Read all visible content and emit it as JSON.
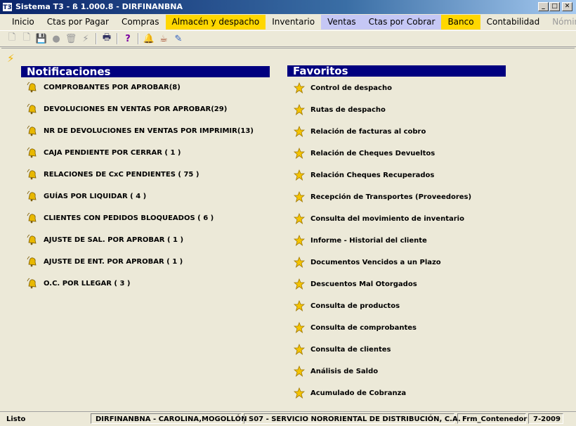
{
  "window": {
    "title": "Sistema T3 - ß 1.000.8 - DIRFINANBNA",
    "icon_label": "T3",
    "controls": [
      "minimize",
      "maximize",
      "close"
    ]
  },
  "menu": [
    {
      "label": "Inicio",
      "style": "normal"
    },
    {
      "label": "Ctas por Pagar",
      "style": "normal"
    },
    {
      "label": "Compras",
      "style": "normal"
    },
    {
      "label": "Almacén y despacho",
      "style": "yellow"
    },
    {
      "label": "Inventario",
      "style": "normal"
    },
    {
      "label": "Ventas",
      "style": "blue"
    },
    {
      "label": "Ctas por Cobrar",
      "style": "blue"
    },
    {
      "label": "Banco",
      "style": "yellow"
    },
    {
      "label": "Contabilidad",
      "style": "normal"
    },
    {
      "label": "Nómina",
      "style": "disabled"
    }
  ],
  "colors": {
    "yellow_menu": "#ffd700",
    "blue_menu": "#c5c7f5",
    "section_header": "#00007f"
  },
  "toolbar": [
    {
      "icon": "new-document-icon",
      "enabled": false
    },
    {
      "icon": "open-document-icon",
      "enabled": false
    },
    {
      "icon": "save-icon",
      "enabled": false
    },
    {
      "icon": "record-icon",
      "enabled": false
    },
    {
      "icon": "delete-icon",
      "enabled": false
    },
    {
      "icon": "lightning-icon",
      "enabled": false
    },
    {
      "icon": "print-icon",
      "enabled": true
    },
    {
      "icon": "help-icon",
      "enabled": true
    },
    {
      "icon": "notification-bell-icon",
      "enabled": true
    },
    {
      "icon": "coffee-cup-icon",
      "enabled": true
    },
    {
      "icon": "syringe-icon",
      "enabled": true
    }
  ],
  "notifications": {
    "title": "Notificaciones",
    "items": [
      "COMPROBANTES POR APROBAR(8)",
      "DEVOLUCIONES EN VENTAS POR APROBAR(29)",
      "NR DE DEVOLUCIONES EN VENTAS POR IMPRIMIR(13)",
      "CAJA PENDIENTE POR CERRAR  ( 1 )",
      "RELACIONES DE CxC PENDIENTES  ( 75 )",
      "GUÍAS POR LIQUIDAR  ( 4 )",
      "CLIENTES CON PEDIDOS BLOQUEADOS  ( 6 )",
      "AJUSTE DE SAL. POR APROBAR  ( 1 )",
      "AJUSTE DE ENT. POR APROBAR  ( 1 )",
      "O.C. POR LLEGAR  ( 3 )"
    ]
  },
  "favorites": {
    "title": "Favoritos",
    "items": [
      "Control de despacho",
      "Rutas de despacho",
      "Relación de facturas al cobro",
      "Relación de Cheques Devueltos",
      "Relación Cheques Recuperados",
      "Recepción de Transportes (Proveedores)",
      "Consulta del movimiento de inventario",
      "Informe - Historial del cliente",
      "Documentos Vencidos a un Plazo",
      "Descuentos Mal Otorgados",
      "Consulta de productos",
      "Consulta de comprobantes",
      "Consulta de clientes",
      "Análisis de Saldo",
      "Acumulado de Cobranza"
    ]
  },
  "statusbar": {
    "status": "Listo",
    "user": "DIRFINANBNA - CAROLINA,MOGOLLÓN",
    "company": "S07 - SERVICIO NORORIENTAL DE DISTRIBUCIÓN, C.A.",
    "form": "Frm_Contenedor",
    "period": "7-2009"
  }
}
